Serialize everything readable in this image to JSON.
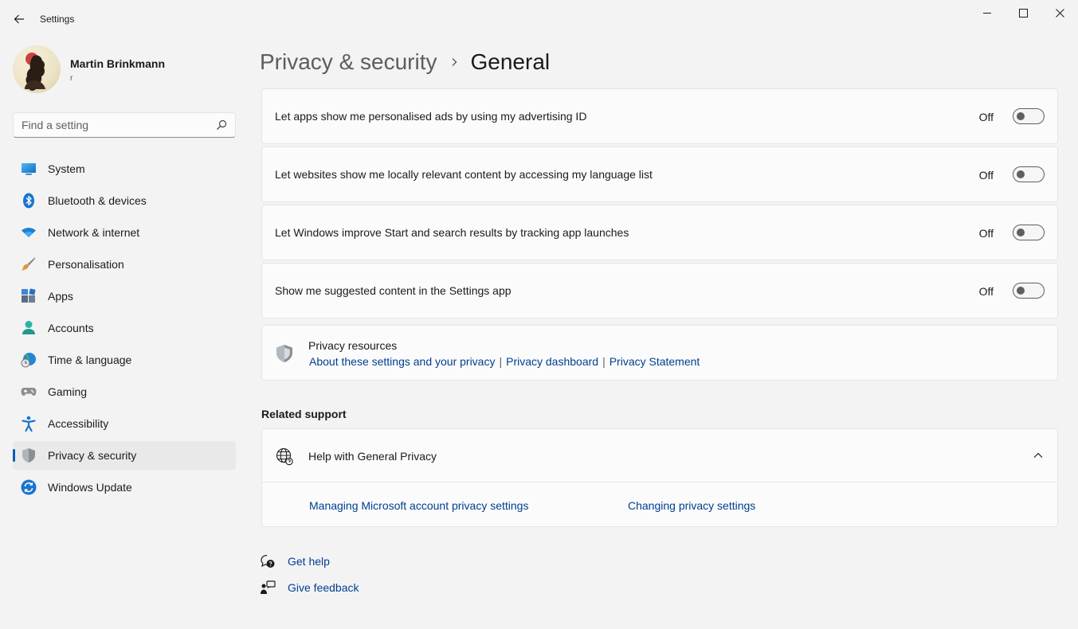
{
  "window": {
    "title": "Settings"
  },
  "profile": {
    "name": "Martin Brinkmann",
    "subtitle": "r"
  },
  "search": {
    "placeholder": "Find a setting"
  },
  "sidebar": {
    "items": [
      {
        "label": "System",
        "icon": "system-icon"
      },
      {
        "label": "Bluetooth & devices",
        "icon": "bluetooth-icon"
      },
      {
        "label": "Network & internet",
        "icon": "wifi-icon"
      },
      {
        "label": "Personalisation",
        "icon": "brush-icon"
      },
      {
        "label": "Apps",
        "icon": "apps-icon"
      },
      {
        "label": "Accounts",
        "icon": "accounts-icon"
      },
      {
        "label": "Time & language",
        "icon": "time-language-icon"
      },
      {
        "label": "Gaming",
        "icon": "gamepad-icon"
      },
      {
        "label": "Accessibility",
        "icon": "accessibility-icon"
      },
      {
        "label": "Privacy & security",
        "icon": "shield-icon",
        "active": true
      },
      {
        "label": "Windows Update",
        "icon": "update-icon"
      }
    ]
  },
  "breadcrumb": {
    "parent": "Privacy & security",
    "current": "General"
  },
  "settings": [
    {
      "label": "Let apps show me personalised ads by using my advertising ID",
      "state": "Off"
    },
    {
      "label": "Let websites show me locally relevant content by accessing my language list",
      "state": "Off"
    },
    {
      "label": "Let Windows improve Start and search results by tracking app launches",
      "state": "Off"
    },
    {
      "label": "Show me suggested content in the Settings app",
      "state": "Off"
    }
  ],
  "resources": {
    "title": "Privacy resources",
    "links": [
      "About these settings and your privacy",
      "Privacy dashboard",
      "Privacy Statement"
    ],
    "separator": "|"
  },
  "related_support": {
    "heading": "Related support",
    "title": "Help with General Privacy",
    "links": [
      "Managing Microsoft account privacy settings",
      "Changing privacy settings"
    ]
  },
  "footer": {
    "get_help": "Get help",
    "give_feedback": "Give feedback"
  },
  "colors": {
    "accent": "#005fb8",
    "link": "#003e92",
    "background": "#f3f3f3",
    "card": "#fbfbfb"
  }
}
